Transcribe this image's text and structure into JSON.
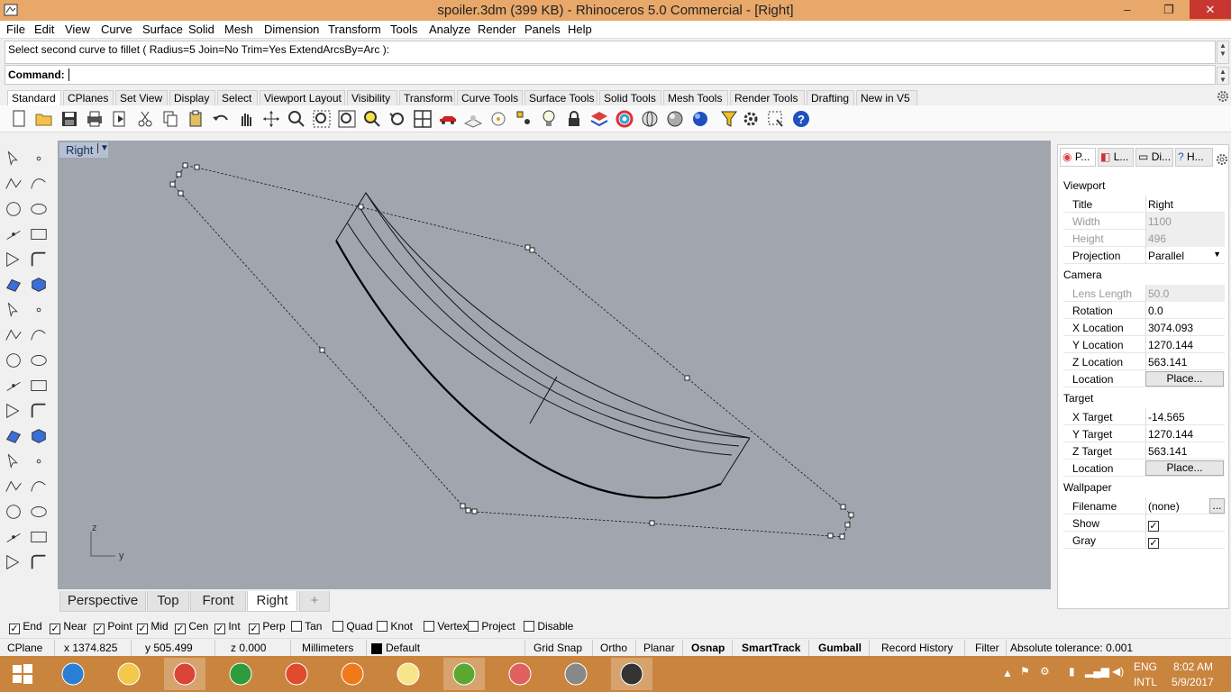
{
  "window": {
    "title": "spoiler.3dm (399 KB) - Rhinoceros 5.0 Commercial - [Right]",
    "minimize": "–",
    "maximize": "❐",
    "close": "✕"
  },
  "menu": [
    "File",
    "Edit",
    "View",
    "Curve",
    "Surface",
    "Solid",
    "Mesh",
    "Dimension",
    "Transform",
    "Tools",
    "Analyze",
    "Render",
    "Panels",
    "Help"
  ],
  "command": {
    "history": "Select second curve to fillet ( Radius=5  Join=No  Trim=Yes  ExtendArcsBy=Arc ):",
    "prompt": "Command:",
    "value": ""
  },
  "tabs": [
    "Standard",
    "CPlanes",
    "Set View",
    "Display",
    "Select",
    "Viewport Layout",
    "Visibility",
    "Transform",
    "Curve Tools",
    "Surface Tools",
    "Solid Tools",
    "Mesh Tools",
    "Render Tools",
    "Drafting",
    "New in V5"
  ],
  "active_tab": "Standard",
  "toolbar_icons": [
    "new-icon",
    "open-icon",
    "save-icon",
    "print-icon",
    "import-icon",
    "cut-icon",
    "copy-icon",
    "paste-icon",
    "undo-icon",
    "pan-icon",
    "rotate-view-icon",
    "zoom-dynamic-icon",
    "zoom-window-icon",
    "zoom-extents-icon",
    "zoom-selected-icon",
    "undo-view-icon",
    "four-viewports-icon",
    "car-icon",
    "grid-options-icon",
    "cplane-icon",
    "point-icon",
    "light-icon",
    "lock-icon",
    "layer-icon",
    "color-wheel-icon",
    "sphere-wire-icon",
    "sphere-render-icon",
    "sphere-blue-icon",
    "sun-filter-icon",
    "settings-icon",
    "select-filter-icon",
    "help-icon"
  ],
  "viewport": {
    "name": "Right",
    "axis_z": "z",
    "axis_y": "y"
  },
  "viewport_tabs": [
    "Perspective",
    "Top",
    "Front",
    "Right"
  ],
  "active_viewport": "Right",
  "add_tab": "+",
  "panel": {
    "tabs": [
      "P...",
      "L...",
      "Di...",
      "H..."
    ],
    "viewport_section": "Viewport",
    "title_label": "Title",
    "title_value": "Right",
    "width_label": "Width",
    "width_value": "1100",
    "height_label": "Height",
    "height_value": "496",
    "projection_label": "Projection",
    "projection_value": "Parallel",
    "camera_section": "Camera",
    "lens_label": "Lens Length",
    "lens_value": "50.0",
    "rotation_label": "Rotation",
    "rotation_value": "0.0",
    "xloc_label": "X Location",
    "xloc_value": "3074.093",
    "yloc_label": "Y Location",
    "yloc_value": "1270.144",
    "zloc_label": "Z Location",
    "zloc_value": "563.141",
    "loc_label": "Location",
    "place_label": "Place...",
    "target_section": "Target",
    "xt_label": "X Target",
    "xt_value": "-14.565",
    "yt_label": "Y Target",
    "yt_value": "1270.144",
    "zt_label": "Z Target",
    "zt_value": "563.141",
    "tloc_label": "Location",
    "tplace_label": "Place...",
    "wallpaper_section": "Wallpaper",
    "filename_label": "Filename",
    "filename_value": "(none)",
    "browse_label": "...",
    "show_label": "Show",
    "gray_label": "Gray"
  },
  "osnaps": [
    {
      "label": "End",
      "checked": true
    },
    {
      "label": "Near",
      "checked": true
    },
    {
      "label": "Point",
      "checked": true
    },
    {
      "label": "Mid",
      "checked": true
    },
    {
      "label": "Cen",
      "checked": true
    },
    {
      "label": "Int",
      "checked": true
    },
    {
      "label": "Perp",
      "checked": true
    },
    {
      "label": "Tan",
      "checked": false
    },
    {
      "label": "Quad",
      "checked": false
    },
    {
      "label": "Knot",
      "checked": false
    },
    {
      "label": "Vertex",
      "checked": false
    },
    {
      "label": "Project",
      "checked": false
    },
    {
      "label": "Disable",
      "checked": false
    }
  ],
  "status": {
    "cplane": "CPlane",
    "x": "x 1374.825",
    "y": "y 505.499",
    "z": "z 0.000",
    "units": "Millimeters",
    "layer": "Default",
    "grid_snap": "Grid Snap",
    "ortho": "Ortho",
    "planar": "Planar",
    "osnap": "Osnap",
    "smarttrack": "SmartTrack",
    "gumball": "Gumball",
    "record_history": "Record History",
    "filter": "Filter",
    "tolerance": "Absolute tolerance: 0.001"
  },
  "taskbar": {
    "apps": [
      "start-icon",
      "ie-icon",
      "explorer-icon",
      "chrome-icon",
      "store-icon",
      "screenshot-icon",
      "firefox-icon",
      "sticky-icon",
      "utorrent-icon",
      "snipping-icon",
      "calculator-icon",
      "rhino-icon"
    ],
    "lang1": "ENG",
    "lang2": "INTL",
    "time": "8:02 AM",
    "date": "5/9/2017"
  }
}
